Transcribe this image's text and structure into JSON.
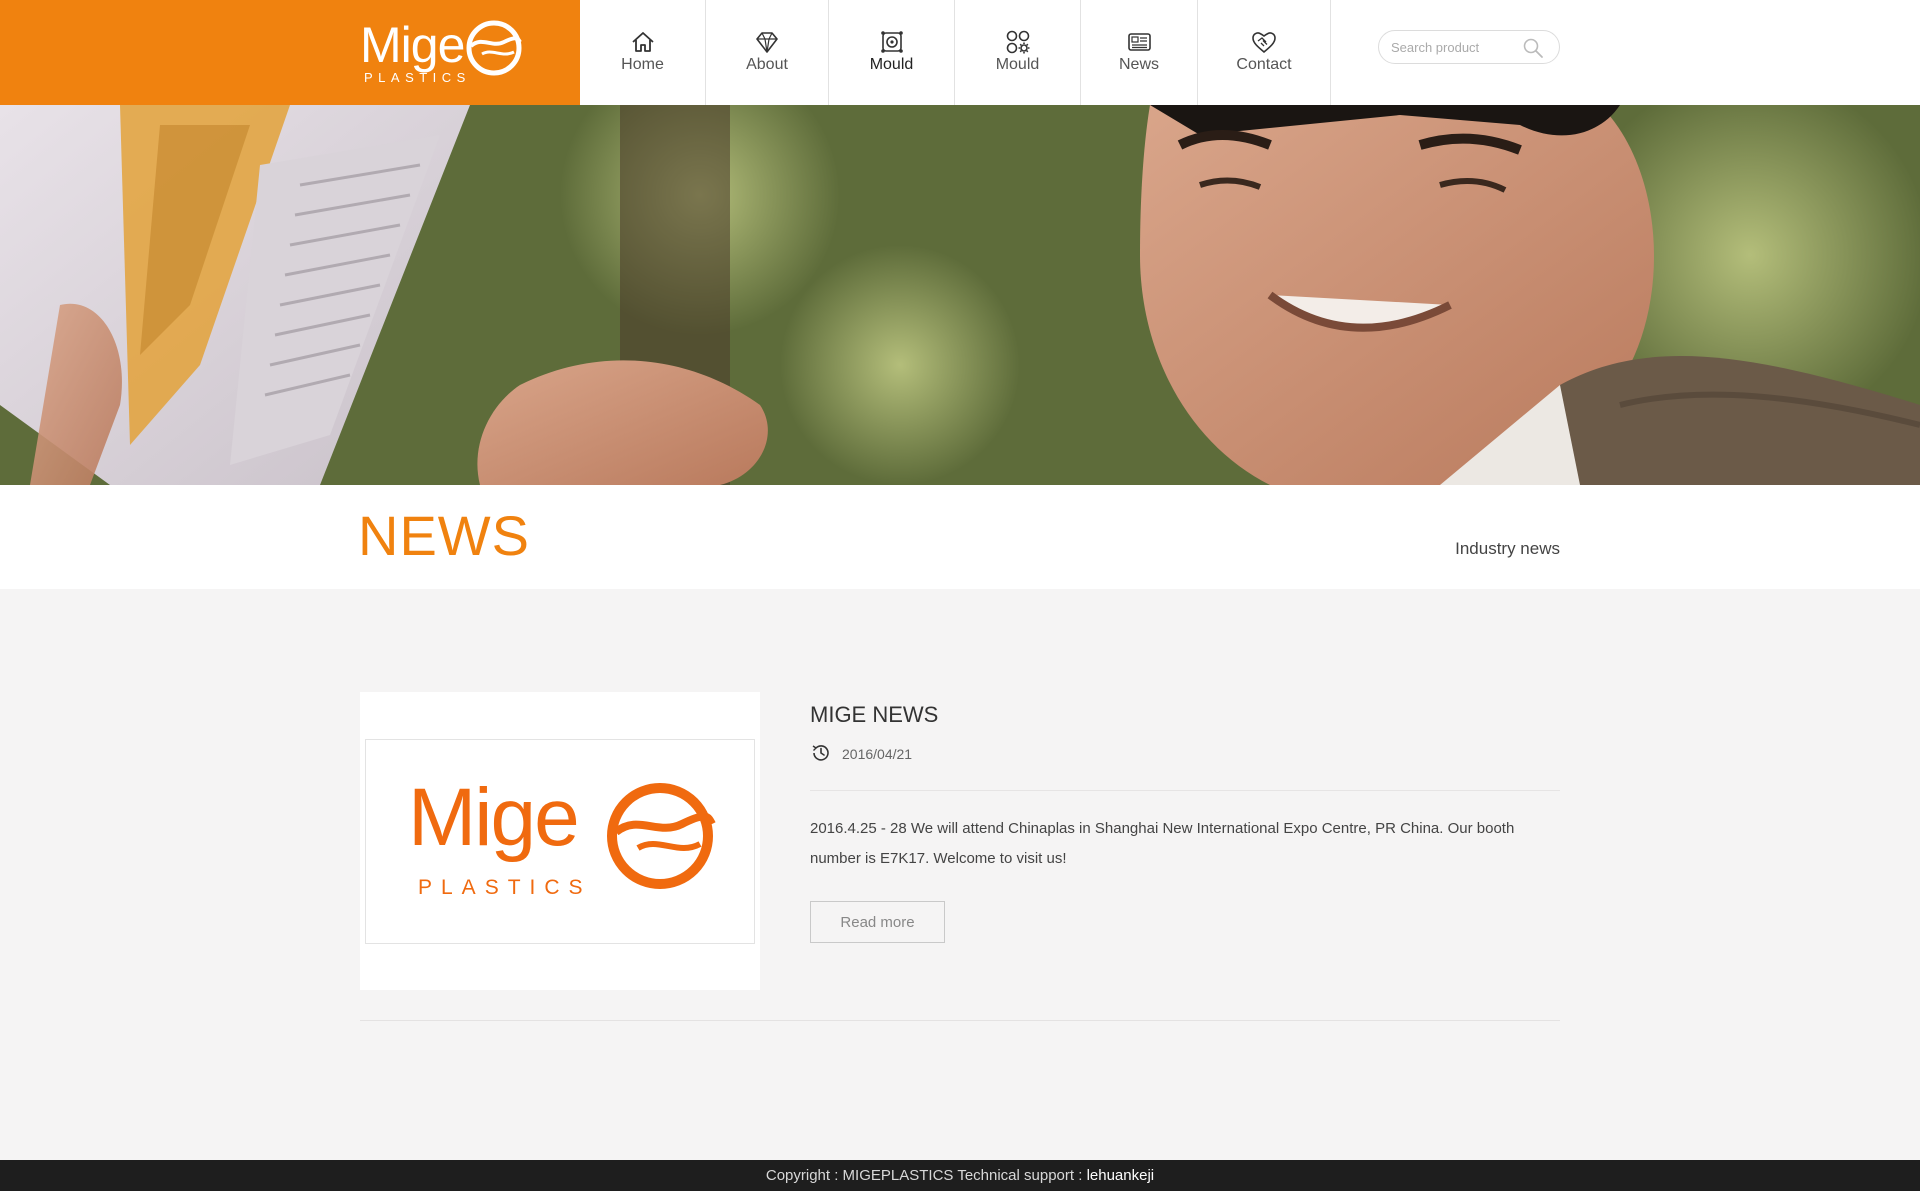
{
  "brand": {
    "name": "Mige",
    "tagline": "PLASTICS",
    "color": "#f0820f"
  },
  "nav": {
    "items": [
      {
        "label": "Home",
        "icon": "home-icon"
      },
      {
        "label": "About",
        "icon": "diamond-icon"
      },
      {
        "label": "Mould",
        "icon": "mould-icon",
        "active": true
      },
      {
        "label": "Mould",
        "icon": "grid-gear-icon"
      },
      {
        "label": "News",
        "icon": "newspaper-icon"
      },
      {
        "label": "Contact",
        "icon": "handshake-icon"
      }
    ]
  },
  "search": {
    "placeholder": "Search product",
    "icon": "search-icon"
  },
  "banner": {
    "image": "man-reading-newspaper-photo"
  },
  "page": {
    "title": "NEWS",
    "category": "Industry news"
  },
  "news": {
    "items": [
      {
        "title": "MIGE NEWS",
        "date": "2016/04/21",
        "summary": "2016.4.25 - 28 We will attend Chinaplas in Shanghai New International Expo Centre, PR China. Our booth number is E7K17. Welcome to visit us!",
        "read_more": "Read more",
        "thumb_word": "Mige",
        "thumb_sub": "PLASTICS"
      }
    ]
  },
  "footer": {
    "copyright": "Copyright : MIGEPLASTICS Technical support : ",
    "support": "lehuankeji"
  },
  "colors": {
    "accent": "#f0820f",
    "background": "#f5f4f4",
    "footer": "#1e1e1e"
  }
}
